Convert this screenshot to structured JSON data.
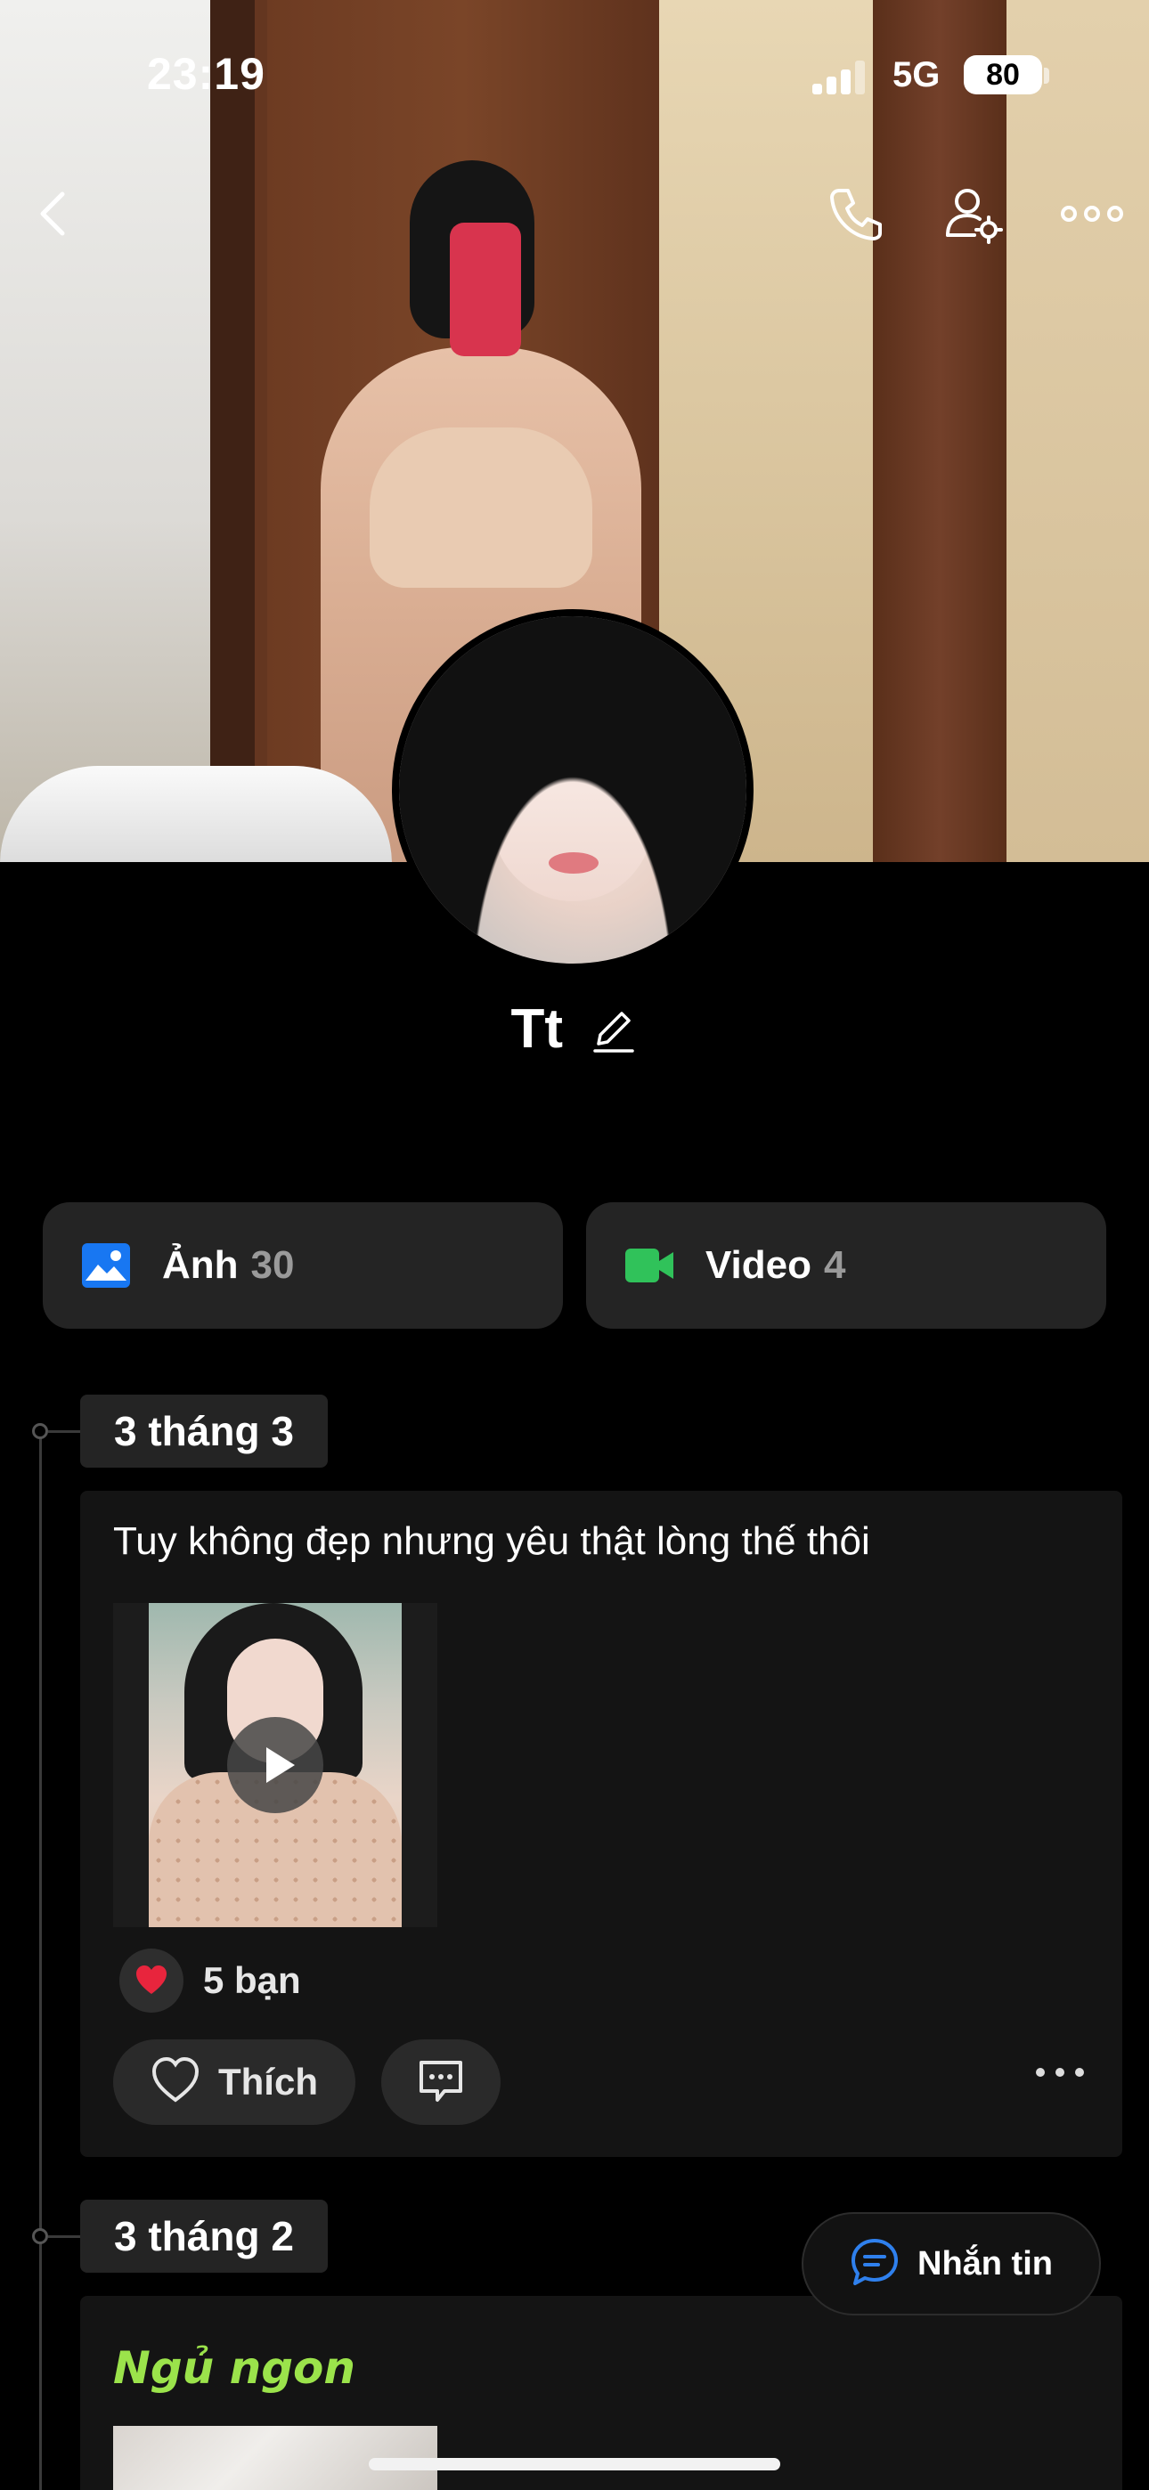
{
  "status_bar": {
    "time": "23:19",
    "network": "5G",
    "battery": "80"
  },
  "profile": {
    "name": "Tt"
  },
  "media_buttons": {
    "photos": {
      "label": "Ảnh",
      "count": "30",
      "icon": "image-icon",
      "icon_color": "#1877f2"
    },
    "videos": {
      "label": "Video",
      "count": "4",
      "icon": "video-camera-icon",
      "icon_color": "#30c25a"
    }
  },
  "timeline": [
    {
      "date": "3 tháng 3",
      "text": "Tuy không đẹp nhưng yêu thật lòng thế thôi",
      "media": "video",
      "reactions": "5 bạn",
      "like_label": "Thích"
    },
    {
      "date": "3 tháng 2",
      "text": "Ngủ ngon",
      "text_color": "#9be34b"
    }
  ],
  "fab": {
    "label": "Nhắn tin"
  },
  "colors": {
    "background": "#000000",
    "card": "#141414",
    "chip": "#242424",
    "heart": "#e8253d"
  }
}
